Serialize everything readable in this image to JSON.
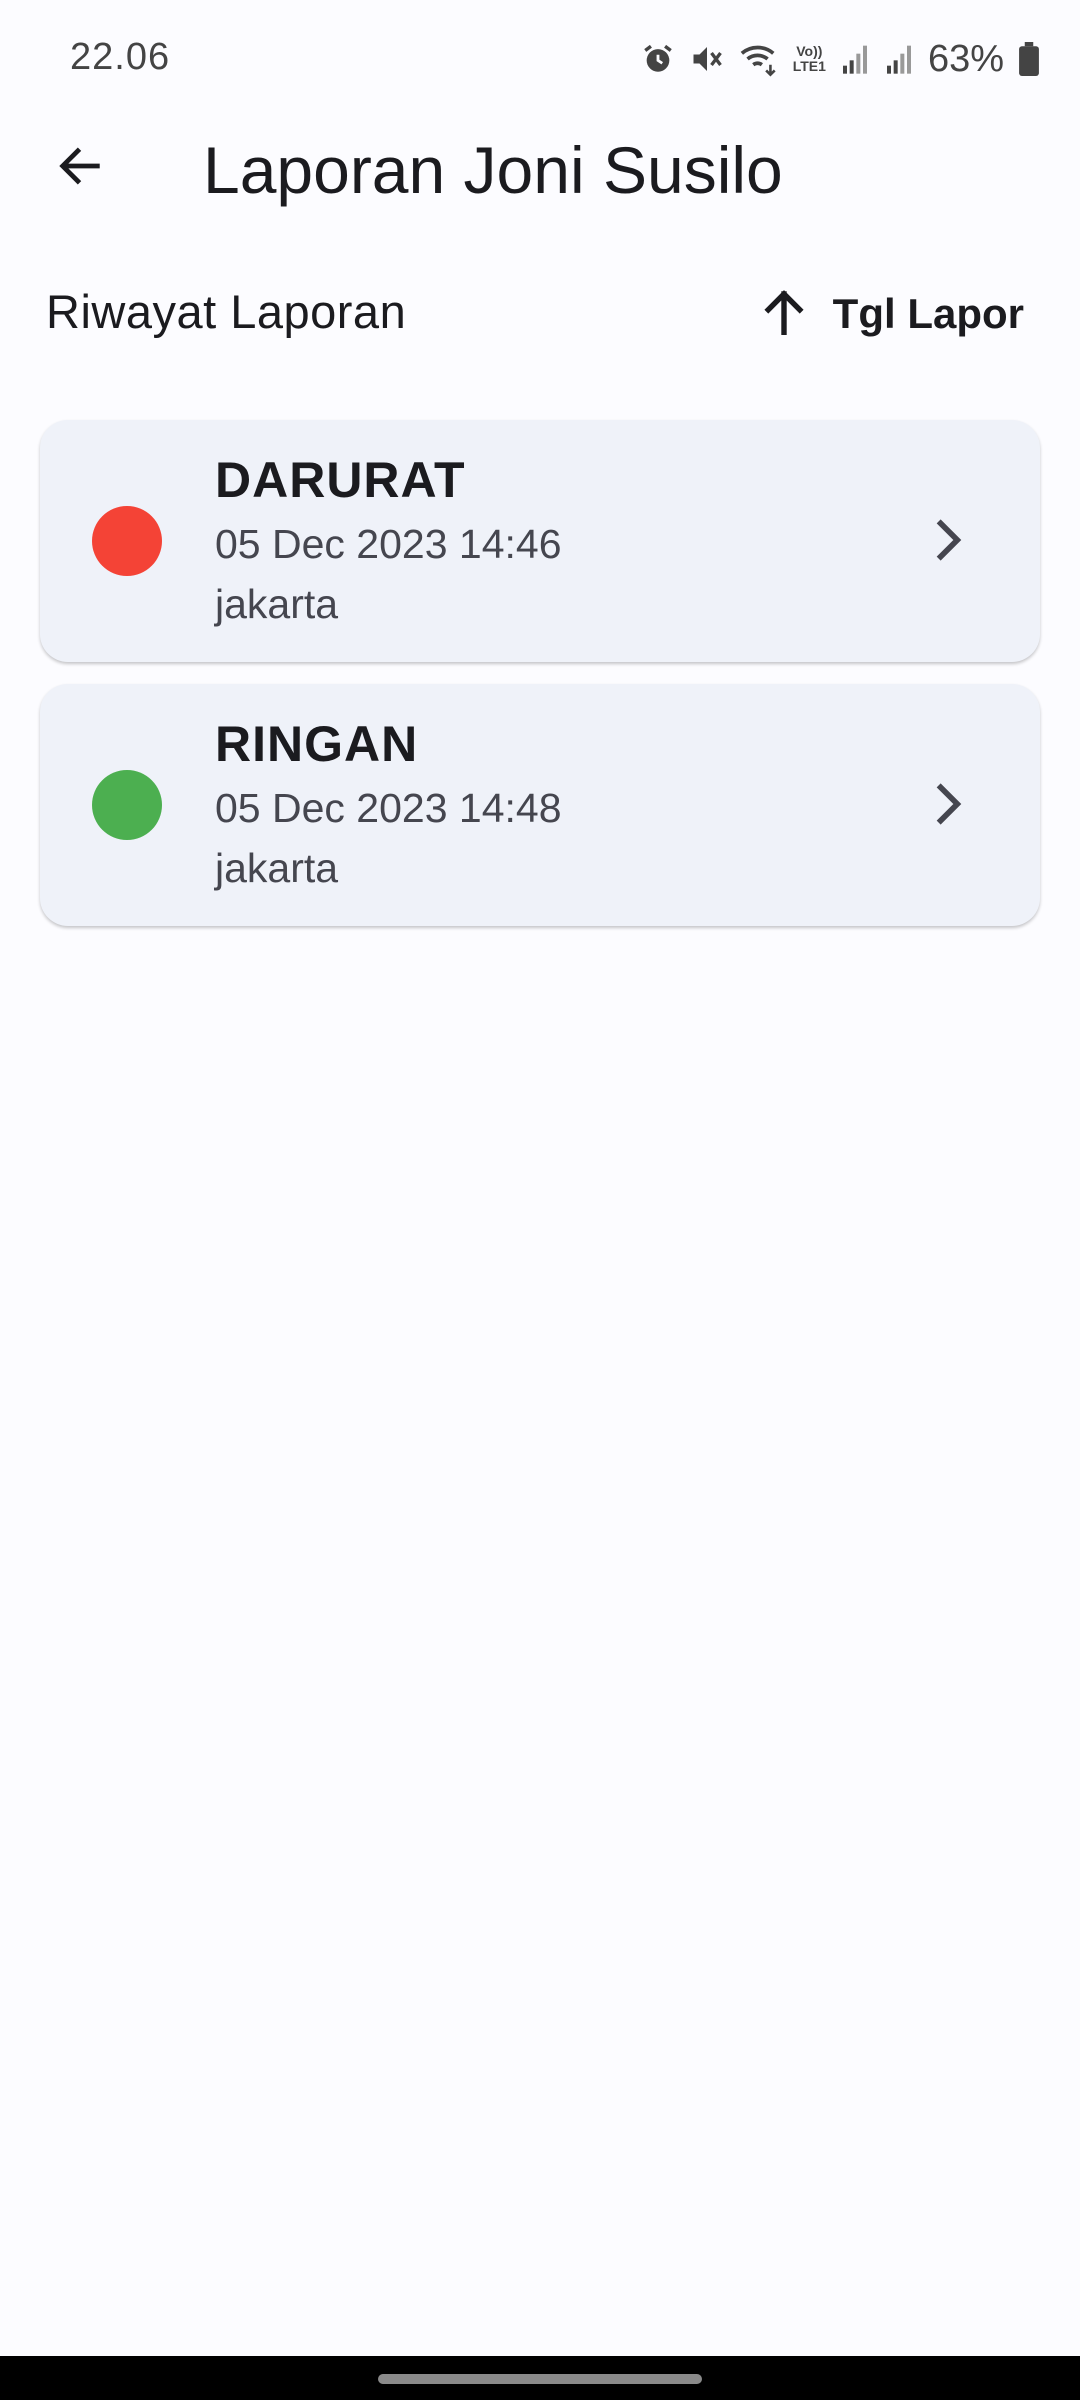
{
  "status_bar": {
    "time": "22.06",
    "battery": "63%",
    "network_label_top": "Vo))",
    "network_label_bottom": "LTE1",
    "icons": [
      "alarm-icon",
      "mute-icon",
      "wifi-icon",
      "signal-icon",
      "signal-icon",
      "battery-icon"
    ]
  },
  "app_bar": {
    "back_icon": "arrow-back-icon",
    "title": "Laporan Joni Susilo"
  },
  "section": {
    "title": "Riwayat Laporan",
    "sort_icon": "arrow-up-icon",
    "sort_label": "Tgl Lapor"
  },
  "reports": [
    {
      "level": "DARURAT",
      "datetime": "05 Dec 2023 14:46",
      "location": "jakarta",
      "status_color": "#f44336"
    },
    {
      "level": "RINGAN",
      "datetime": "05 Dec 2023 14:48",
      "location": "jakarta",
      "status_color": "#4caf50"
    }
  ],
  "colors": {
    "background": "#fcfcff",
    "card": "#eff2f9",
    "emergency": "#f44336",
    "minor": "#4caf50"
  }
}
